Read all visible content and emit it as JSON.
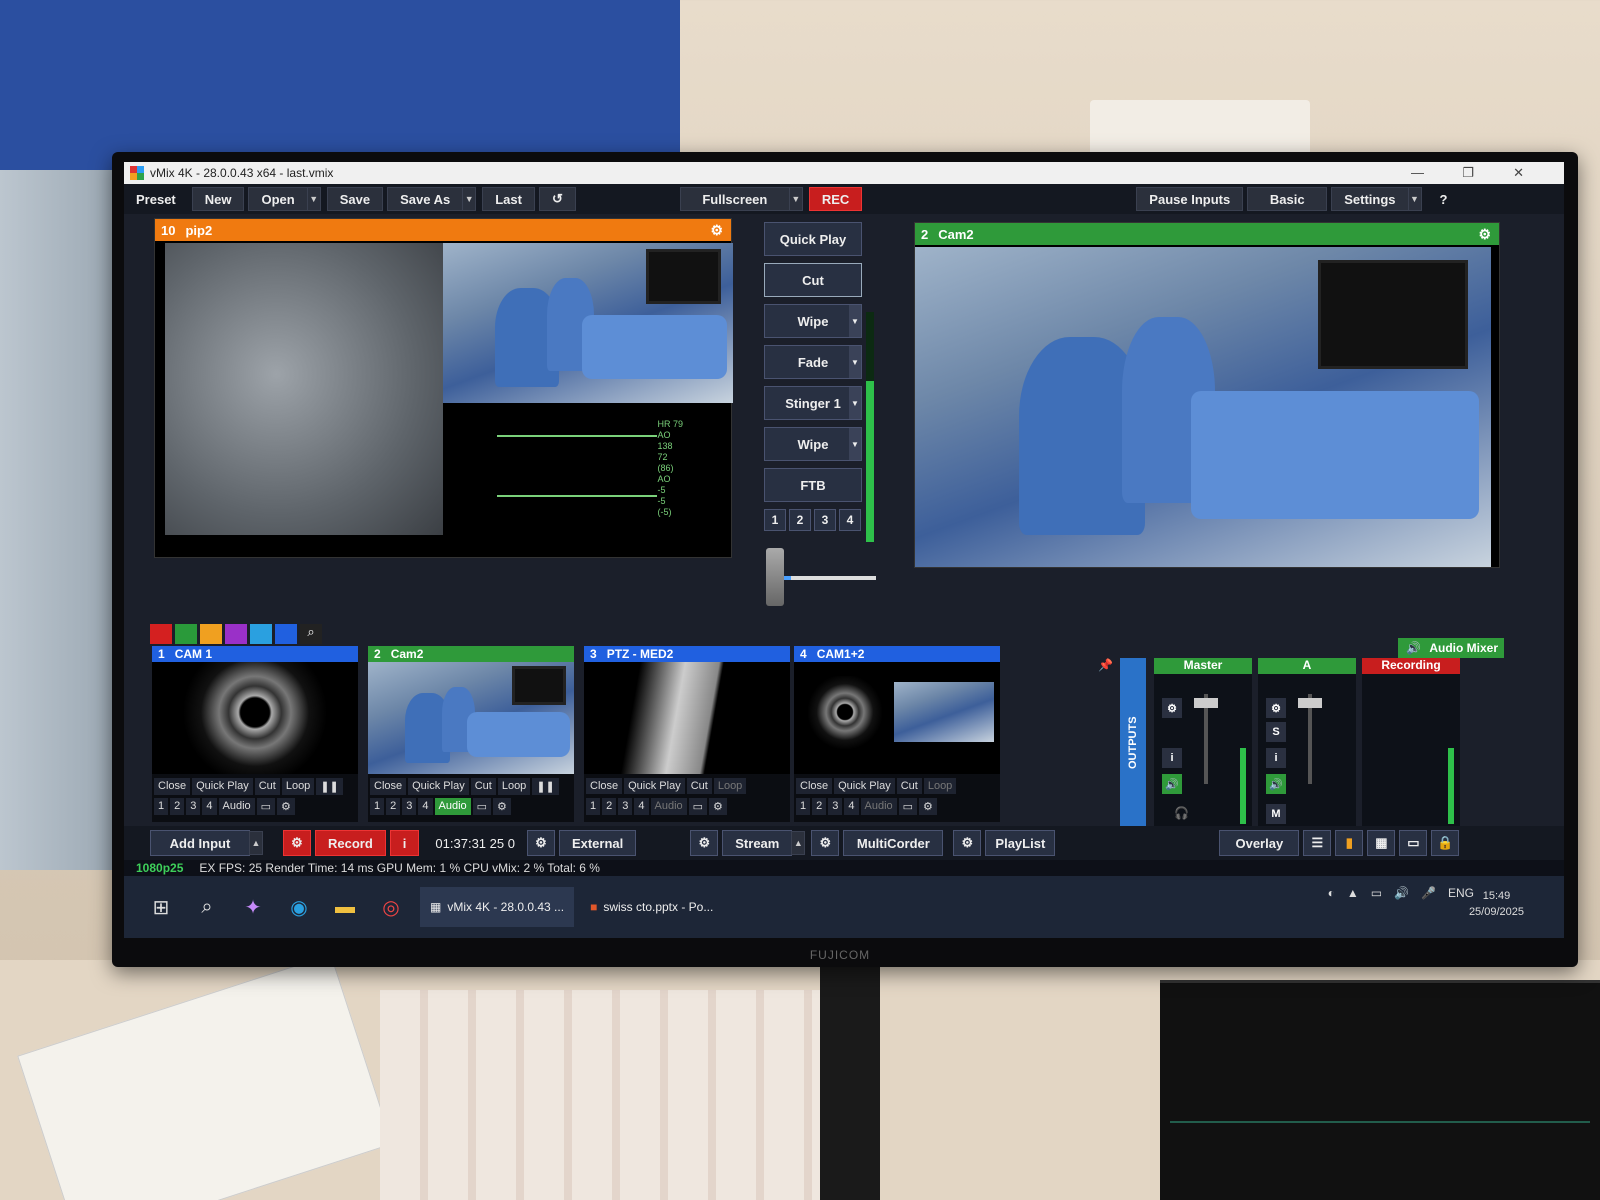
{
  "window": {
    "title": "vMix 4K - 28.0.0.43 x64 - last.vmix",
    "minimize": "—",
    "restore": "❐",
    "close": "✕"
  },
  "toolbar": {
    "preset": "Preset",
    "new": "New",
    "open": "Open",
    "save": "Save",
    "save_as": "Save As",
    "last": "Last",
    "fullscreen": "Fullscreen",
    "rec": "REC",
    "pause_inputs": "Pause Inputs",
    "basic": "Basic",
    "settings": "Settings",
    "help": "?"
  },
  "preview": {
    "number": "10",
    "name": "pip2",
    "monitor_text": [
      "HR 79",
      "AO",
      "138",
      "72",
      "(86)",
      "AO",
      "-5",
      "-5",
      "(-5)"
    ]
  },
  "output": {
    "number": "2",
    "name": "Cam2"
  },
  "transitions": {
    "quick_play": "Quick Play",
    "cut": "Cut",
    "wipe": "Wipe",
    "fade": "Fade",
    "stinger": "Stinger 1",
    "wipe2": "Wipe",
    "ftb": "FTB",
    "numbers": [
      "1",
      "2",
      "3",
      "4"
    ],
    "tbar_position": 0.12
  },
  "colors": [
    "#d42020",
    "#2a9a3a",
    "#f0a020",
    "#9a30c8",
    "#2aa0e0",
    "#2060e0"
  ],
  "inputs": [
    {
      "number": "1",
      "name": "CAM 1",
      "color": "#2060e0",
      "buttons": [
        "Close",
        "Quick Play",
        "Cut",
        "Loop"
      ],
      "nums": [
        "1",
        "2",
        "3",
        "4"
      ],
      "audio": "Audio",
      "audio_on": false
    },
    {
      "number": "2",
      "name": "Cam2",
      "color": "#2f9a3a",
      "buttons": [
        "Close",
        "Quick Play",
        "Cut",
        "Loop"
      ],
      "nums": [
        "1",
        "2",
        "3",
        "4"
      ],
      "audio": "Audio",
      "audio_on": true
    },
    {
      "number": "3",
      "name": "PTZ - MED2",
      "color": "#2060e0",
      "buttons": [
        "Close",
        "Quick Play",
        "Cut",
        "Loop"
      ],
      "nums": [
        "1",
        "2",
        "3",
        "4"
      ],
      "audio": "Audio",
      "audio_on": false
    },
    {
      "number": "4",
      "name": "CAM1+2",
      "color": "#2060e0",
      "buttons": [
        "Close",
        "Quick Play",
        "Cut",
        "Loop"
      ],
      "nums": [
        "1",
        "2",
        "3",
        "4"
      ],
      "audio": "Audio",
      "audio_on": false
    }
  ],
  "audio_mixer": {
    "label": "Audio Mixer",
    "outputs": "OUTPUTS",
    "buses": [
      {
        "name": "Master",
        "color": "#2f9a3a"
      },
      {
        "name": "A",
        "color": "#2f9a3a"
      },
      {
        "name": "Recording",
        "color": "#c81e1e"
      }
    ],
    "btn_i": "i",
    "btn_s": "S",
    "btn_m": "M"
  },
  "bottom": {
    "add_input": "Add Input",
    "record": "Record",
    "rec_info": "i",
    "timecode": "01:37:31 25 0",
    "external": "External",
    "stream": "Stream",
    "multicorder": "MultiCorder",
    "playlist": "PlayList",
    "overlay": "Overlay"
  },
  "status": {
    "format": "1080p25",
    "text": "EX FPS: 25 Render Time: 14 ms GPU Mem: 1 % CPU vMix: 2 % Total: 6 %"
  },
  "taskbar": {
    "app1": "vMix 4K - 28.0.0.43 ...",
    "app2": "swiss cto.pptx - Po...",
    "lang": "ENG",
    "time": "15:49",
    "date": "25/09/2025"
  },
  "monitor_brand": "FUJICOM"
}
